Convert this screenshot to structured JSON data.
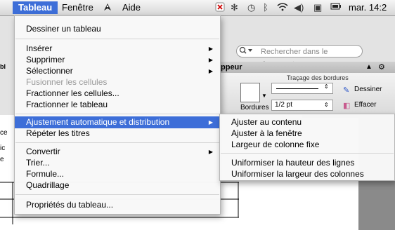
{
  "menubar": {
    "items": [
      "Tableau",
      "Fenêtre",
      "Aide"
    ],
    "script_icon": "script-menu-icon",
    "clock": "mar. 14:2",
    "status_icons": [
      "close-x-icon",
      "bluetooth-like-icon",
      "time-machine-icon",
      "bluetooth-icon",
      "wifi-icon",
      "volume-icon",
      "display-icon",
      "battery-icon"
    ]
  },
  "document": {
    "search_placeholder": "Rechercher dans le document",
    "ribbon_tab_label": "ppeur",
    "ribbon_group_title": "Traçage des bordures",
    "bordures_label": "Bordures",
    "line_weight": "1/2 pt",
    "draw_label": "Dessiner",
    "erase_label": "Effacer",
    "left_edge_letters": [
      "bl",
      "ce",
      "ic",
      "e"
    ]
  },
  "menu": {
    "items": [
      {
        "label": "Dessiner un tableau",
        "submenu": false,
        "disabled": false
      },
      {
        "label": "Insérer",
        "submenu": true,
        "disabled": false
      },
      {
        "label": "Supprimer",
        "submenu": true,
        "disabled": false
      },
      {
        "label": "Sélectionner",
        "submenu": true,
        "disabled": false
      },
      {
        "label": "Fusionner les cellules",
        "submenu": false,
        "disabled": true
      },
      {
        "label": "Fractionner les cellules...",
        "submenu": false,
        "disabled": false
      },
      {
        "label": "Fractionner le tableau",
        "submenu": false,
        "disabled": false
      },
      {
        "label": "Ajustement automatique et distribution",
        "submenu": true,
        "disabled": false,
        "highlighted": true
      },
      {
        "label": "Répéter les titres",
        "submenu": false,
        "disabled": false
      },
      {
        "label": "Convertir",
        "submenu": true,
        "disabled": false
      },
      {
        "label": "Trier...",
        "submenu": false,
        "disabled": false
      },
      {
        "label": "Formule...",
        "submenu": false,
        "disabled": false
      },
      {
        "label": "Quadrillage",
        "submenu": false,
        "disabled": false
      },
      {
        "label": "Propriétés du tableau...",
        "submenu": false,
        "disabled": false
      }
    ]
  },
  "submenu": {
    "items": [
      "Ajuster au contenu",
      "Ajuster à la fenêtre",
      "Largeur de colonne fixe",
      "Uniformiser la hauteur des lignes",
      "Uniformiser la largeur des colonnes"
    ]
  },
  "colors": {
    "highlight": "#3d6ed8",
    "disabled_text": "#9a9a9a"
  }
}
